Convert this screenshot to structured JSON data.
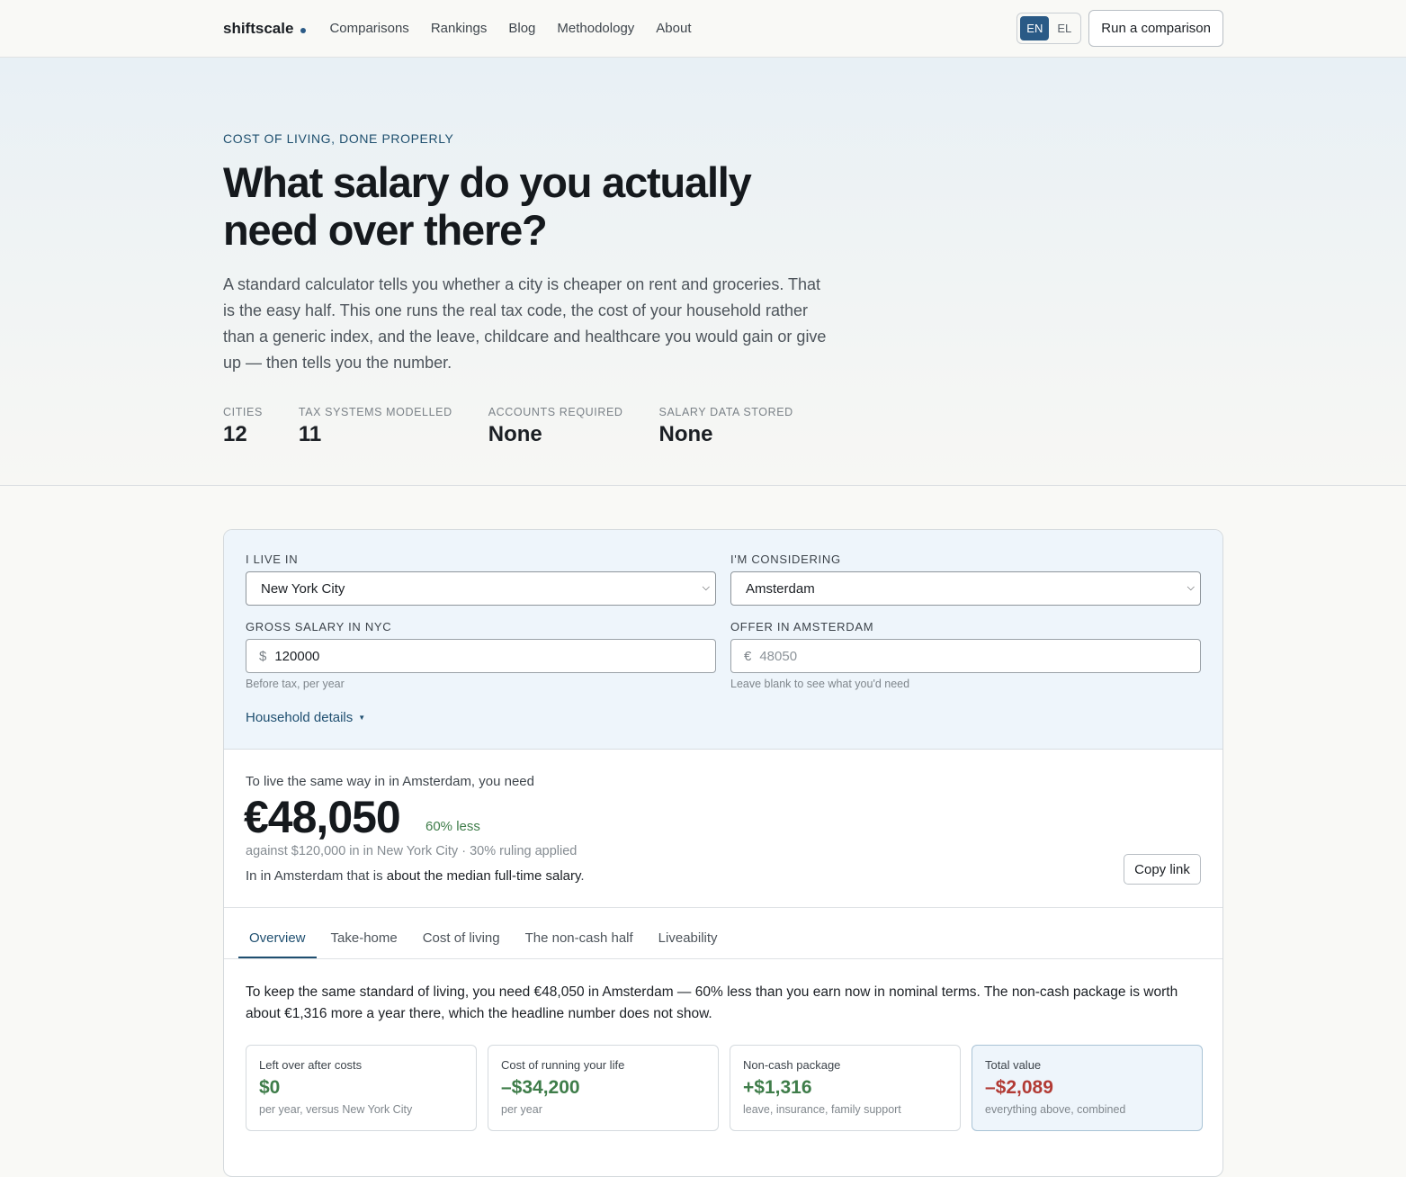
{
  "header": {
    "logo": "shiftscale",
    "nav": [
      "Comparisons",
      "Rankings",
      "Blog",
      "Methodology",
      "About"
    ],
    "lang": [
      "EN",
      "EL"
    ],
    "run_button": "Run a comparison"
  },
  "hero": {
    "eyebrow": "COST OF LIVING, DONE PROPERLY",
    "title": "What salary do you actually need over there?",
    "lede": "A standard calculator tells you whether a city is cheaper on rent and groceries. That is the easy half. This one runs the real tax code, the cost of your household rather than a generic index, and the leave, childcare and healthcare you would gain or give up — then tells you the number.",
    "stats": [
      {
        "label": "CITIES",
        "value": "12"
      },
      {
        "label": "TAX SYSTEMS MODELLED",
        "value": "11"
      },
      {
        "label": "ACCOUNTS REQUIRED",
        "value": "None"
      },
      {
        "label": "SALARY DATA STORED",
        "value": "None"
      }
    ]
  },
  "form": {
    "live_label": "I LIVE IN",
    "live_value": "New York City",
    "consider_label": "I'M CONSIDERING",
    "consider_value": "Amsterdam",
    "gross_label": "GROSS SALARY IN NYC",
    "gross_currency": "$",
    "gross_value": "120000",
    "gross_hint": "Before tax, per year",
    "offer_label": "OFFER IN AMSTERDAM",
    "offer_currency": "€",
    "offer_placeholder": "48050",
    "offer_hint": "Leave blank to see what you'd need",
    "household": "Household details"
  },
  "result": {
    "lead": "To live the same way in in Amsterdam, you need",
    "amount": "€48,050",
    "delta": "60% less",
    "against": "against $120,000 in in New York City · 30% ruling applied",
    "median_prefix": "In in Amsterdam that is ",
    "median_bold": "about the median full-time salary",
    "median_suffix": ".",
    "copy": "Copy link"
  },
  "tabs": [
    "Overview",
    "Take-home",
    "Cost of living",
    "The non-cash half",
    "Liveability"
  ],
  "overview_text": "To keep the same standard of living, you need €48,050 in Amsterdam — 60% less than you earn now in nominal terms. The non-cash package is worth about €1,316 more a year there, which the headline number does not show.",
  "tiles": [
    {
      "label": "Left over after costs",
      "value": "$0",
      "sub": "per year, versus New York City",
      "tone": "pos"
    },
    {
      "label": "Cost of running your life",
      "value": "–$34,200",
      "sub": "per year",
      "tone": "pos"
    },
    {
      "label": "Non-cash package",
      "value": "+$1,316",
      "sub": "leave, insurance, family support",
      "tone": "pos"
    },
    {
      "label": "Total value",
      "value": "–$2,089",
      "sub": "everything above, combined",
      "tone": "neg"
    }
  ],
  "colors": {
    "accent": "#2a5a86",
    "positive": "#3f7d4a",
    "negative": "#b23b35",
    "panel": "#eef5fb"
  }
}
